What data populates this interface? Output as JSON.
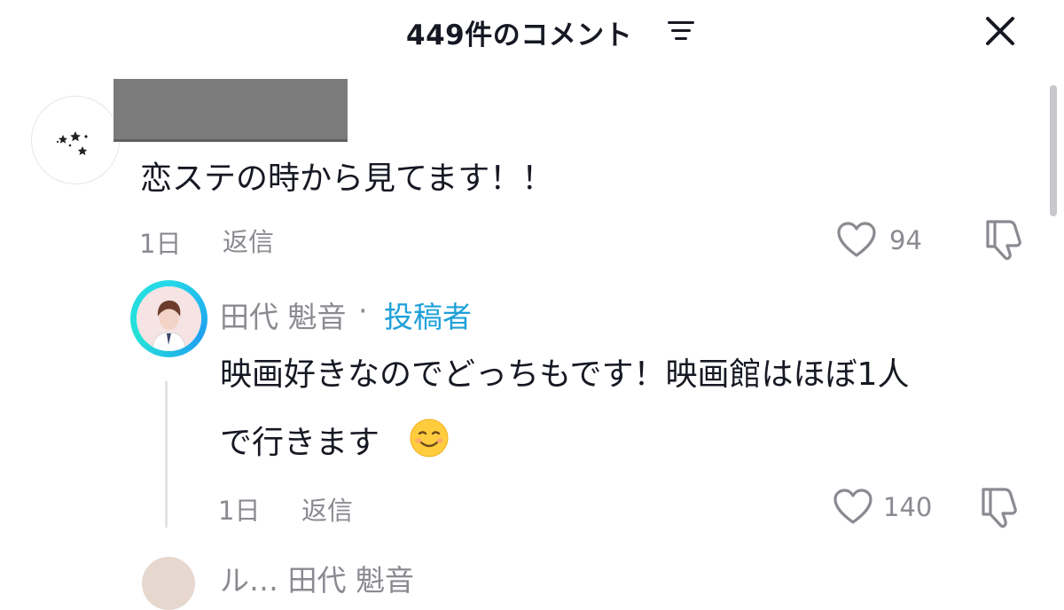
{
  "header": {
    "title": "449件のコメント",
    "sort_icon": "filter-lines-icon",
    "close_icon": "close-icon"
  },
  "comments": [
    {
      "username_redacted": true,
      "avatar": "sparkle-stars-avatar",
      "text": "恋ステの時から見てます！！",
      "time": "1日",
      "reply_label": "返信",
      "likes": "94",
      "replies": [
        {
          "username": "田代 魁音",
          "separator": "·",
          "badge": "投稿者",
          "text_line1": "映画好きなのでどっちもです！映画館はほぼ1人",
          "text_line2": "で行きます",
          "emoji": "smiling-face-emoji",
          "time": "1日",
          "reply_label": "返信",
          "likes": "140"
        }
      ]
    }
  ],
  "peek": {
    "username": "ル… 田代 魁音"
  },
  "colors": {
    "text_primary": "#161823",
    "text_secondary": "#8a8b91",
    "author_badge": "#1fa0d8",
    "story_ring": "#25d8e8"
  }
}
